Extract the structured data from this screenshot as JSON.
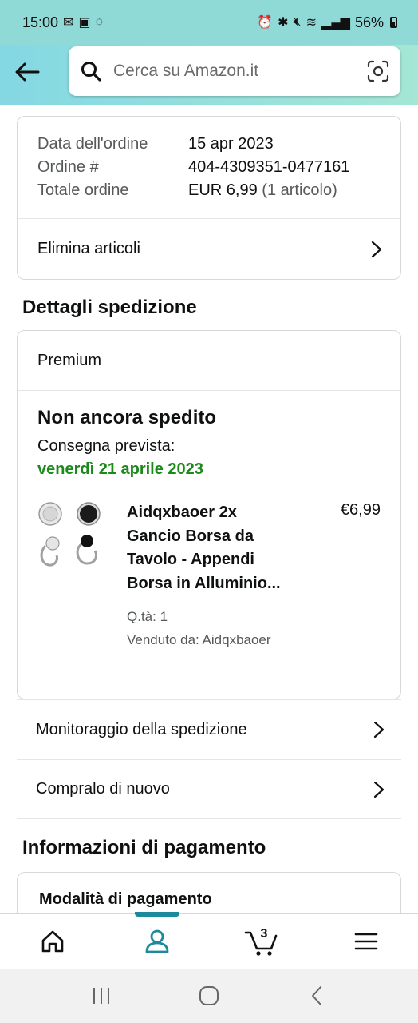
{
  "status_bar": {
    "time": "15:00",
    "battery": "56%"
  },
  "search": {
    "placeholder": "Cerca su Amazon.it"
  },
  "order_summary": {
    "rows": [
      {
        "label": "Data dell'ordine",
        "value": "15 apr 2023",
        "extra": ""
      },
      {
        "label": "Ordine #",
        "value": "404-4309351-0477161",
        "extra": ""
      },
      {
        "label": "Totale ordine",
        "value": "EUR 6,99",
        "extra": "(1 articolo)"
      }
    ],
    "delete_link": "Elimina articoli"
  },
  "shipping": {
    "section_title": "Dettagli spedizione",
    "service": "Premium",
    "status": "Non ancora spedito",
    "delivery_label": "Consegna prevista:",
    "delivery_date": "venerdì 21 aprile 2023",
    "product": {
      "title": "Aidqxbaoer 2x Gancio Borsa da Tavolo - Appendi Borsa in Alluminio...",
      "price": "€6,99",
      "quantity": "Q.tà: 1",
      "seller": "Venduto da: Aidqxbaoer"
    },
    "tracking_link": "Monitoraggio della spedizione",
    "buy_again_link": "Compralo di nuovo"
  },
  "payment": {
    "section_title": "Informazioni di pagamento",
    "method_label": "Modalità di pagamento"
  },
  "bottom_nav": {
    "cart_count": "3",
    "active": "account"
  },
  "colors": {
    "header_start": "#84D8E3",
    "header_end": "#A5E6D6",
    "delivery_green": "#1A8A1A",
    "active_nav": "#1B8A9A"
  }
}
